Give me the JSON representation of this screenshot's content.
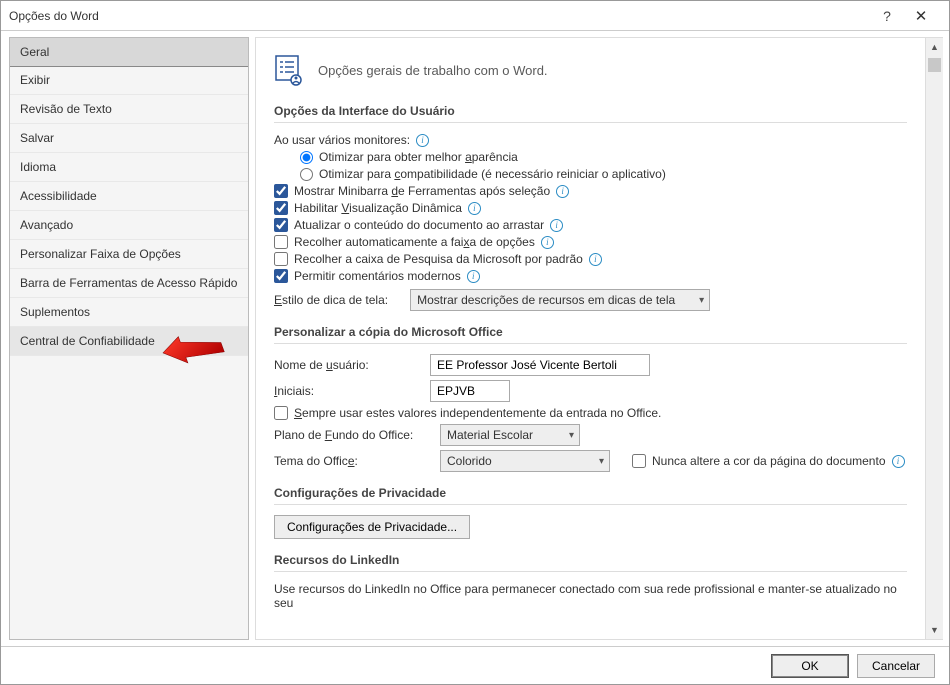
{
  "window": {
    "title": "Opções do Word"
  },
  "sidebar": {
    "items": [
      {
        "label": "Geral",
        "state": "selected"
      },
      {
        "label": "Exibir"
      },
      {
        "label": "Revisão de Texto"
      },
      {
        "label": "Salvar"
      },
      {
        "label": "Idioma"
      },
      {
        "label": "Acessibilidade"
      },
      {
        "label": "Avançado"
      },
      {
        "label": "Personalizar Faixa de Opções"
      },
      {
        "label": "Barra de Ferramentas de Acesso Rápido"
      },
      {
        "label": "Suplementos"
      },
      {
        "label": "Central de Confiabilidade",
        "state": "hovered"
      }
    ]
  },
  "header": {
    "text": "Opções gerais de trabalho com o Word."
  },
  "sections": {
    "ui": {
      "title": "Opções da Interface do Usuário",
      "monitors_label": "Ao usar vários monitores:",
      "radio_optimize_appearance_pre": "Otimizar para obter melhor ",
      "radio_optimize_appearance_key": "a",
      "radio_optimize_appearance_post": "parência",
      "radio_optimize_compat_pre": "Otimizar para ",
      "radio_optimize_compat_key": "c",
      "radio_optimize_compat_post": "ompatibilidade (é necessário reiniciar o aplicativo)",
      "chk_minibar_pre": "Mostrar Minibarra ",
      "chk_minibar_key": "d",
      "chk_minibar_post": "e Ferramentas após seleção",
      "chk_live_pre": "Habilitar ",
      "chk_live_key": "V",
      "chk_live_post": "isualização Dinâmica",
      "chk_drag": "Atualizar o conteúdo do documento ao arrastar",
      "chk_collapse_pre": "Recolher automaticamente a fai",
      "chk_collapse_key": "x",
      "chk_collapse_post": "a de opções",
      "chk_search": "Recolher a caixa de Pesquisa da Microsoft por padrão",
      "chk_comments": "Permitir comentários modernos",
      "screentip_label_pre": "",
      "screentip_label_key": "E",
      "screentip_label_post": "stilo de dica de tela:",
      "screentip_value": "Mostrar descrições de recursos em dicas de tela"
    },
    "office": {
      "title": "Personalizar a cópia do Microsoft Office",
      "username_label_pre": "Nome de ",
      "username_label_key": "u",
      "username_label_post": "suário:",
      "username_value": "EE Professor José Vicente Bertoli",
      "initials_label_key": "I",
      "initials_label_post": "niciais:",
      "initials_value": "EPJVB",
      "always_use_pre": "",
      "always_use_key": "S",
      "always_use_post": "empre usar estes valores independentemente da entrada no Office.",
      "background_label_pre": "Plano de ",
      "background_label_key": "F",
      "background_label_post": "undo do Office:",
      "background_value": "Material Escolar",
      "theme_label_pre": "Tema do Offic",
      "theme_label_key": "e",
      "theme_label_post": ":",
      "theme_value": "Colorido",
      "never_change": "Nunca altere a cor da página do documento"
    },
    "privacy": {
      "title": "Configurações de Privacidade",
      "button": "Configurações de Privacidade..."
    },
    "linkedin": {
      "title": "Recursos do LinkedIn",
      "desc": "Use recursos do LinkedIn no Office para permanecer conectado com sua rede profissional e manter-se atualizado no seu"
    }
  },
  "footer": {
    "ok": "OK",
    "cancel": "Cancelar"
  }
}
